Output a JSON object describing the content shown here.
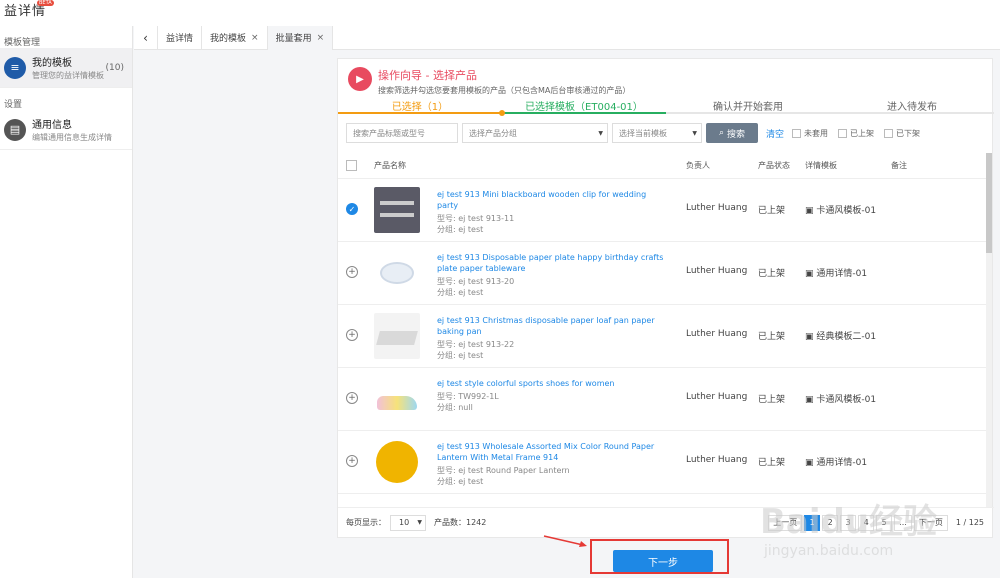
{
  "app": {
    "title": "益详情",
    "badge": "BETA"
  },
  "sidebar": {
    "section1": "模板管理",
    "item1": {
      "label": "我的模板",
      "sub": "管理您的益详情模板",
      "count": "(10)"
    },
    "section2": "设置",
    "item2": {
      "label": "通用信息",
      "sub": "编辑通用信息生成详情"
    }
  },
  "tabs": [
    {
      "label": "益详情"
    },
    {
      "label": "我的模板"
    },
    {
      "label": "批量套用"
    }
  ],
  "guide": {
    "title": "操作向导 - 选择产品",
    "sub": "搜索筛选并勾选您要套用模板的产品（只包含MA后台审核通过的产品）"
  },
  "steps": [
    "已选择（1）",
    "已选择模板（ET004-01）",
    "确认并开始套用",
    "进入待发布"
  ],
  "filters": {
    "search_placeholder": "搜索产品标题或型号",
    "group": "选择产品分组",
    "template": "选择当前模板",
    "search_btn": "搜索",
    "clear": "清空",
    "cb1": "未套用",
    "cb2": "已上架",
    "cb3": "已下架"
  },
  "table": {
    "headers": [
      "产品名称",
      "负责人",
      "产品状态",
      "详情模板",
      "备注"
    ],
    "rows": [
      {
        "name": "ej test 913 Mini blackboard wooden clip for wedding party",
        "model": "型号: ej test 913-11",
        "group": "分组: ej test",
        "owner": "Luther Huang",
        "status": "已上架",
        "template": "卡通风模板-01",
        "checked": true
      },
      {
        "name": "ej test 913 Disposable paper plate happy birthday crafts plate paper tableware",
        "model": "型号: ej test 913-20",
        "group": "分组: ej test",
        "owner": "Luther Huang",
        "status": "已上架",
        "template": "通用详情-01",
        "checked": false
      },
      {
        "name": "ej test 913 Christmas disposable paper loaf pan paper baking pan",
        "model": "型号: ej test 913-22",
        "group": "分组: ej test",
        "owner": "Luther Huang",
        "status": "已上架",
        "template": "经典模板二-01",
        "checked": false
      },
      {
        "name": "ej test style colorful sports shoes for women",
        "model": "型号: TW992-1L",
        "group": "分组: null",
        "owner": "Luther Huang",
        "status": "已上架",
        "template": "卡通风模板-01",
        "checked": false
      },
      {
        "name": "ej test 913 Wholesale Assorted Mix Color Round Paper Lantern With Metal Frame 914",
        "model": "型号: ej test Round Paper Lantern",
        "group": "分组: ej test",
        "owner": "Luther Huang",
        "status": "已上架",
        "template": "通用详情-01",
        "checked": false
      }
    ]
  },
  "footer": {
    "per_page_label": "每页显示：",
    "per_page": "10",
    "count": "产品数：1242",
    "pages": [
      "上一页",
      "1",
      "2",
      "3",
      "4",
      "5",
      "...",
      "下一页"
    ],
    "page_info": "1 / 125"
  },
  "next_button": "下一步",
  "watermark": {
    "text": "Baidu经验",
    "url": "jingyan.baidu.com"
  }
}
